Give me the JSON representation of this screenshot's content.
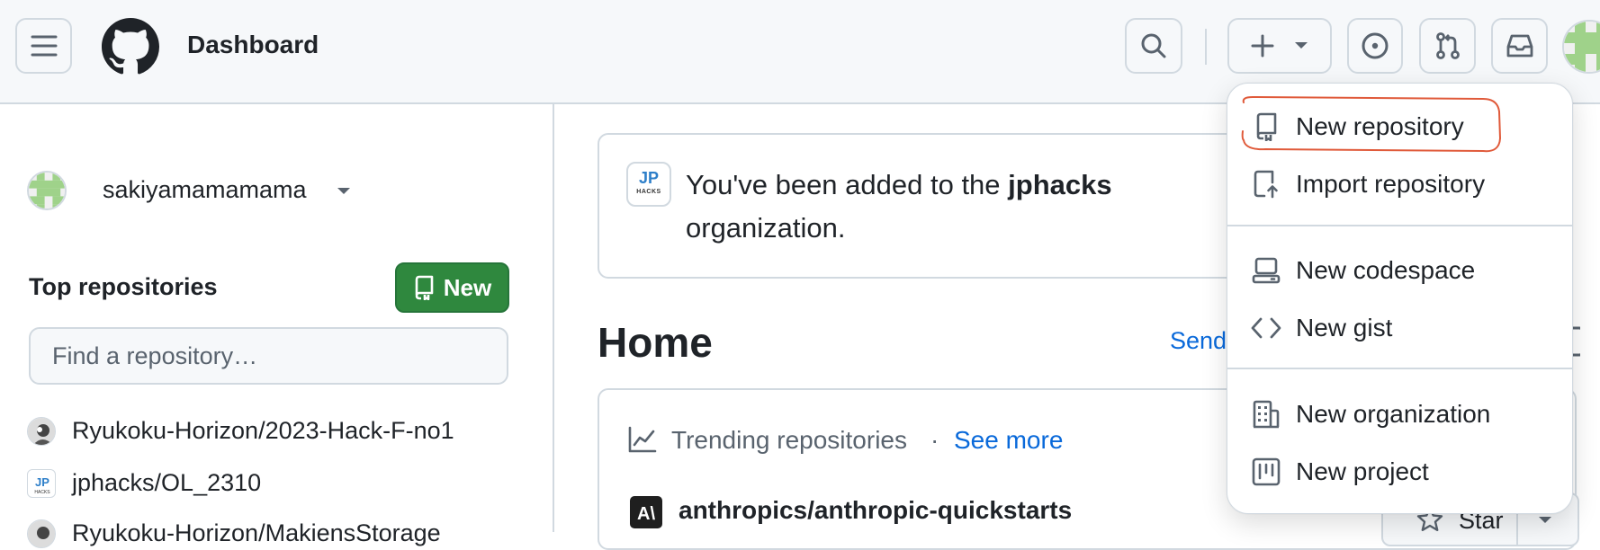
{
  "header": {
    "title": "Dashboard"
  },
  "sidebar": {
    "username": "sakiyamamamama",
    "top_repos_heading": "Top repositories",
    "new_button_label": "New",
    "search_placeholder": "Find a repository…",
    "repos": [
      {
        "name": "Ryukoku-Horizon/2023-Hack-F-no1"
      },
      {
        "name": "jphacks/OL_2310"
      },
      {
        "name": "Ryukoku-Horizon/MakiensStorage"
      }
    ]
  },
  "notice": {
    "text_before": "You've been added to the ",
    "org": "jphacks",
    "text_after": "organization.",
    "logo_top": "JP",
    "logo_bottom": "HACKS"
  },
  "main": {
    "home_title": "Home",
    "send_link": "Send",
    "trending_label": "Trending repositories",
    "separator": "·",
    "see_more": "See more",
    "trending_repo": "anthropics/anthropic-quickstarts",
    "star_label": "Star"
  },
  "menu": {
    "items": [
      {
        "label": "New repository",
        "icon": "repo-icon"
      },
      {
        "label": "Import repository",
        "icon": "repo-push-icon"
      },
      {
        "label": "New codespace",
        "icon": "codespaces-icon"
      },
      {
        "label": "New gist",
        "icon": "code-icon"
      },
      {
        "label": "New organization",
        "icon": "organization-icon"
      },
      {
        "label": "New project",
        "icon": "project-icon"
      }
    ]
  },
  "colors": {
    "accent_link": "#0969da",
    "new_button": "#2f883e",
    "annotation_circle": "#e05a3a"
  }
}
